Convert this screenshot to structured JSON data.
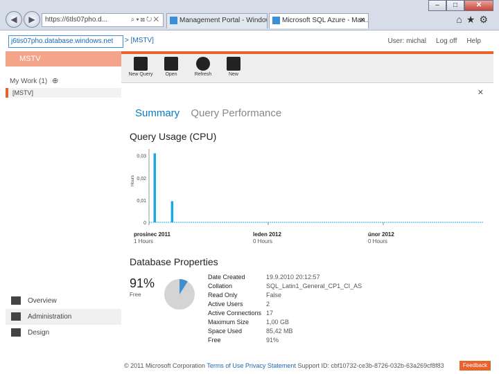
{
  "browser": {
    "address": "https://6tls07pho.d...",
    "tabs": [
      {
        "label": "Management Portal - Window..."
      },
      {
        "label": "Microsoft SQL Azure - Man..."
      }
    ]
  },
  "header": {
    "server": "j6tis07pho.database.windows.net",
    "breadcrumb": "> [MSTV]",
    "links": [
      "User: michal",
      "Log off",
      "Help"
    ]
  },
  "sidebar": {
    "db_name": "MSTV",
    "my_work": "My Work (1)",
    "item": "[MSTV]",
    "bottom_items": [
      {
        "label": "Overview",
        "icon": "overview-icon"
      },
      {
        "label": "Administration",
        "icon": "administration-icon"
      },
      {
        "label": "Design",
        "icon": "design-icon"
      }
    ]
  },
  "ribbon": {
    "buttons": [
      {
        "label": "New Query",
        "icon": "new-query-icon"
      },
      {
        "label": "Open",
        "icon": "folder-icon"
      },
      {
        "label": "Refresh",
        "icon": "refresh-icon"
      },
      {
        "label": "New",
        "icon": "new-db-icon"
      }
    ]
  },
  "content": {
    "tabs": [
      "Summary",
      "Query Performance"
    ],
    "usage_title": "Query Usage (CPU)",
    "props_title": "Database Properties",
    "free_pct": "91%",
    "free_label": "Free",
    "properties": [
      {
        "k": "Date Created",
        "v": "19.9.2010 20:12:57"
      },
      {
        "k": "Collation",
        "v": "SQL_Latin1_General_CP1_CI_AS"
      },
      {
        "k": "Read Only",
        "v": "False"
      },
      {
        "k": "Active Users",
        "v": "2"
      },
      {
        "k": "Active Connections",
        "v": "17"
      },
      {
        "k": "Maximum Size",
        "v": "1,00 GB"
      },
      {
        "k": "Space Used",
        "v": "85,42 MB"
      },
      {
        "k": "Free",
        "v": "91%"
      }
    ]
  },
  "chart_data": {
    "type": "bar",
    "title": "Query Usage (CPU)",
    "ylabel": "Hours",
    "yticks": [
      "0,03",
      "0,02",
      "0,01",
      "0"
    ],
    "ylim": [
      0,
      0.033
    ],
    "x_labels": [
      {
        "month": "prosinec 2011",
        "hours": "1 Hours"
      },
      {
        "month": "leden 2012",
        "hours": "0 Hours"
      },
      {
        "month": "únor 2012",
        "hours": "0 Hours"
      }
    ],
    "bars": [
      {
        "index": 1,
        "value": 0.031
      },
      {
        "index": 6,
        "value": 0.0095
      }
    ],
    "total_slots": 96,
    "color": "#1aa9e0"
  },
  "pie_data": {
    "free": 91,
    "used": 9,
    "free_color": "#d4d4d4",
    "used_color": "#3e8fd0"
  },
  "footer": {
    "copyright": "© 2011 Microsoft Corporation",
    "terms": "Terms of Use",
    "privacy": "Privacy Statement",
    "support": "Support ID: cbf10732-ce3b-8726-032b-63a269cf8f83",
    "feedback": "Feedback"
  }
}
